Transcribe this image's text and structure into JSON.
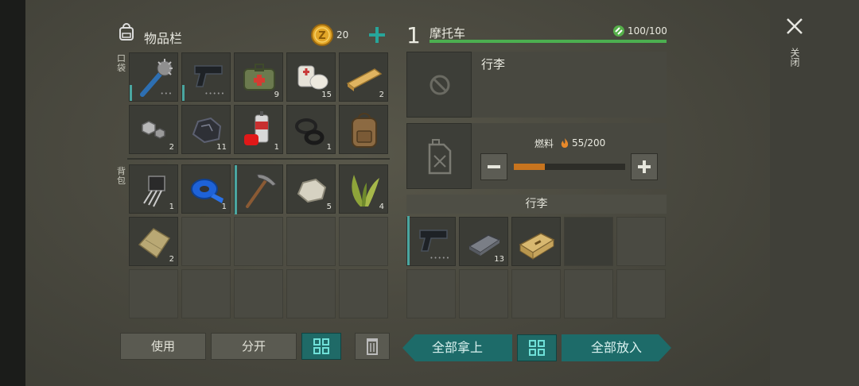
{
  "inventory": {
    "title": "物品栏",
    "coins": "20",
    "pocket_label": "口袋",
    "backpack_label": "背包",
    "pocket_slots": [
      {
        "icon": "spiked-club-icon",
        "qty": "",
        "dots": "•••",
        "durability": true
      },
      {
        "icon": "pistol-icon",
        "qty": "",
        "dots": "•••••",
        "durability": true
      },
      {
        "icon": "first-aid-bag-icon",
        "qty": "9"
      },
      {
        "icon": "bandage-icon",
        "qty": "15"
      },
      {
        "icon": "wood-plank-icon",
        "qty": "2"
      },
      {
        "icon": "bolt-nut-icon",
        "qty": "2"
      },
      {
        "icon": "coal-icon",
        "qty": "11"
      },
      {
        "icon": "spray-can-icon",
        "qty": "1"
      },
      {
        "icon": "rubber-rings-icon",
        "qty": "1"
      },
      {
        "icon": "backpack-icon",
        "qty": ""
      }
    ],
    "backpack_slots": [
      {
        "icon": "circuit-chip-icon",
        "qty": "1"
      },
      {
        "icon": "blue-tape-icon",
        "qty": "1"
      },
      {
        "icon": "pickaxe-icon",
        "qty": "",
        "durability": true
      },
      {
        "icon": "stone-icon",
        "qty": "5"
      },
      {
        "icon": "plant-fiber-icon",
        "qty": "4"
      },
      {
        "icon": "cloth-icon",
        "qty": "2"
      }
    ],
    "use_label": "使用",
    "split_label": "分开"
  },
  "vehicle": {
    "number": "1",
    "name": "摩托车",
    "health": "100/100",
    "health_fraction": 1.0,
    "slot_label": "行李",
    "fuel_label": "燃料",
    "fuel_value": "55/200",
    "fuel_fraction": 0.275,
    "trunk_title": "行李",
    "trunk_slots": [
      {
        "icon": "pistol-icon",
        "qty": "",
        "dots": "•••••",
        "durability": true
      },
      {
        "icon": "metal-ingot-icon",
        "qty": "13"
      },
      {
        "icon": "ammo-crate-icon",
        "qty": ""
      }
    ]
  },
  "actions": {
    "take_all": "全部拿上",
    "put_all": "全部放入"
  },
  "close_label": "关闭",
  "colors": {
    "accent": "#1f6a67",
    "health": "#4caf50",
    "fuel": "#c8741e"
  }
}
